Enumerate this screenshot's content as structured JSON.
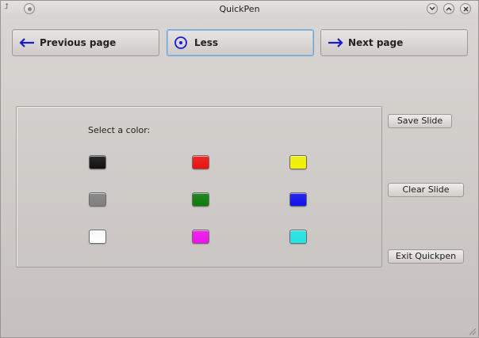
{
  "window": {
    "title": "QuickPen"
  },
  "titlebar": {
    "menu_icon": "pin-icon",
    "menu_button_icon": "window-menu-icon",
    "minimize_icon": "chevron-down-icon",
    "maximize_icon": "chevron-up-icon",
    "close_icon": "close-icon"
  },
  "nav": {
    "previous": {
      "label": "Previous page",
      "icon": "arrow-left-icon"
    },
    "less": {
      "label": "Less",
      "icon": "circle-dot-icon"
    },
    "next": {
      "label": "Next page",
      "icon": "arrow-right-icon"
    }
  },
  "colors_panel": {
    "label": "Select a color:",
    "swatches": [
      {
        "name": "black",
        "color": "#111111"
      },
      {
        "name": "red",
        "color": "#ee1111"
      },
      {
        "name": "yellow",
        "color": "#f2f200"
      },
      {
        "name": "gray",
        "color": "#808080"
      },
      {
        "name": "green",
        "color": "#0b7d0b"
      },
      {
        "name": "blue",
        "color": "#1111ee"
      },
      {
        "name": "white",
        "color": "#ffffff"
      },
      {
        "name": "magenta",
        "color": "#ee11ee"
      },
      {
        "name": "cyan",
        "color": "#22e5e5"
      }
    ]
  },
  "side": {
    "save": "Save Slide",
    "clear": "Clear Slide",
    "exit": "Exit Quickpen"
  },
  "accent": "#1a1ad0"
}
